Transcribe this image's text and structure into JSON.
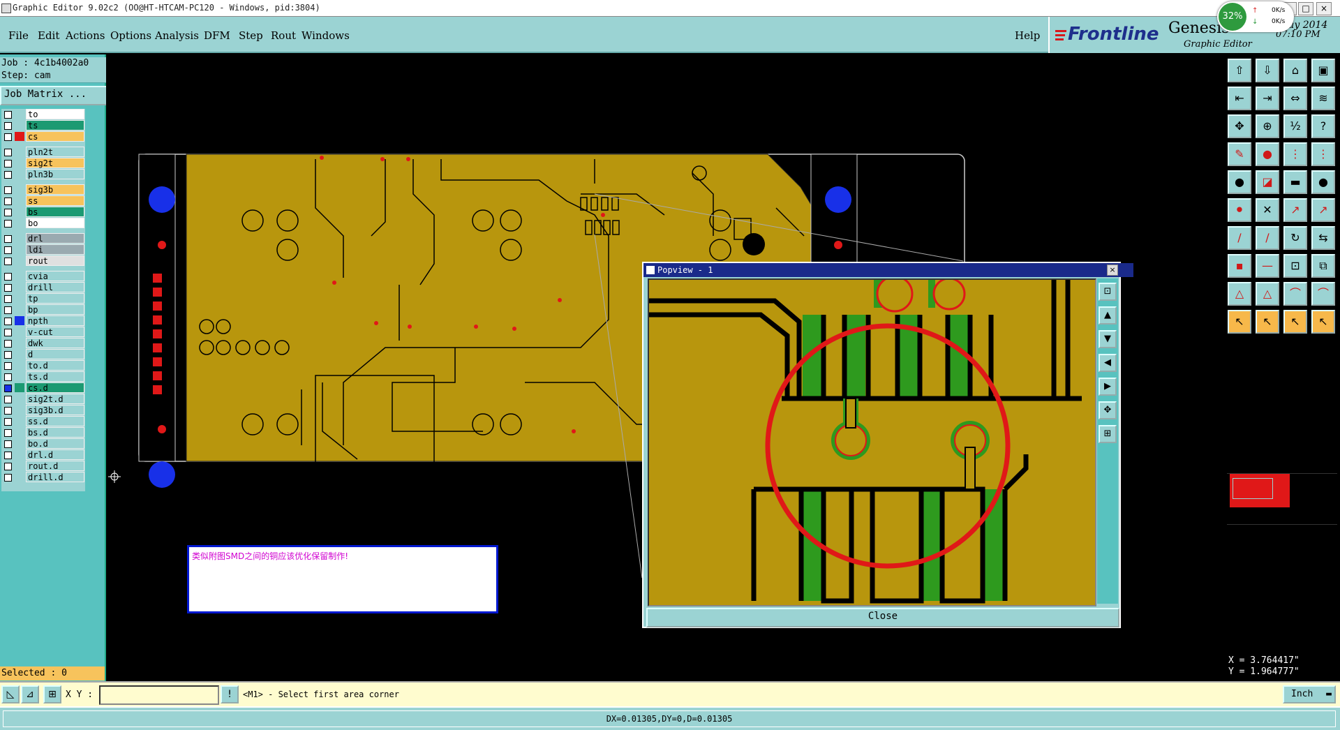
{
  "window": {
    "title": "Graphic Editor 9.02c2 (OO@HT-HTCAM-PC120 - Windows, pid:3804)"
  },
  "menu": [
    "File",
    "Edit",
    "Actions",
    "Options",
    "Analysis",
    "DFM",
    "Step",
    "Rout",
    "Windows"
  ],
  "help_label": "Help",
  "brand": {
    "logo": "Frontline",
    "product": "Genesis",
    "product_sub": "Graphic Editor",
    "date_partial": "ay 2014",
    "time": "07:10 PM",
    "colors": {
      "logo_red": "#d8181c",
      "logo_blue": "#1e2f8c"
    }
  },
  "net_meter": {
    "percent": "32%",
    "up": "0K/s",
    "down": "0K/s",
    "color": "#2e9a3e"
  },
  "job": {
    "job_label": "Job : 4c1b4002a0",
    "step_label": "Step: cam",
    "matrix_button": "Job Matrix ..."
  },
  "layers": [
    {
      "name": "to",
      "bg": "#ffffff",
      "swatch": "",
      "checked": false
    },
    {
      "name": "ts",
      "bg": "#1c9a72",
      "swatch": "",
      "checked": false
    },
    {
      "name": "cs",
      "bg": "#f7c35c",
      "swatch": "#e01818",
      "checked": false
    },
    {
      "name": "pln2t",
      "bg": "#9bd3d3",
      "swatch": "",
      "checked": false
    },
    {
      "name": "sig2t",
      "bg": "#f7c35c",
      "swatch": "",
      "checked": false
    },
    {
      "name": "pln3b",
      "bg": "#9bd3d3",
      "swatch": "",
      "checked": false
    },
    {
      "name": "sig3b",
      "bg": "#f7c35c",
      "swatch": "",
      "checked": false
    },
    {
      "name": "ss",
      "bg": "#f7c35c",
      "swatch": "",
      "checked": false
    },
    {
      "name": "bs",
      "bg": "#1c9a72",
      "swatch": "",
      "checked": false
    },
    {
      "name": "bo",
      "bg": "#ffffff",
      "swatch": "",
      "checked": false
    },
    {
      "name": "drl",
      "bg": "#9aaab0",
      "swatch": "",
      "checked": false
    },
    {
      "name": "ldi",
      "bg": "#9aaab0",
      "swatch": "",
      "checked": false
    },
    {
      "name": "rout",
      "bg": "#e0e0e0",
      "swatch": "",
      "checked": false
    },
    {
      "name": "cvia",
      "bg": "#9bd3d3",
      "swatch": "",
      "checked": false
    },
    {
      "name": "drill",
      "bg": "#9bd3d3",
      "swatch": "",
      "checked": false
    },
    {
      "name": "tp",
      "bg": "#9bd3d3",
      "swatch": "",
      "checked": false
    },
    {
      "name": "bp",
      "bg": "#9bd3d3",
      "swatch": "",
      "checked": false
    },
    {
      "name": "npth",
      "bg": "#9bd3d3",
      "swatch": "#1830e8",
      "checked": false
    },
    {
      "name": "v-cut",
      "bg": "#9bd3d3",
      "swatch": "",
      "checked": false
    },
    {
      "name": "dwk",
      "bg": "#9bd3d3",
      "swatch": "",
      "checked": false
    },
    {
      "name": "d",
      "bg": "#9bd3d3",
      "swatch": "",
      "checked": false
    },
    {
      "name": "to.d",
      "bg": "#9bd3d3",
      "swatch": "",
      "checked": false
    },
    {
      "name": "ts.d",
      "bg": "#9bd3d3",
      "swatch": "",
      "checked": false
    },
    {
      "name": "cs.d",
      "bg": "#1c9a72",
      "swatch": "#1c9a72",
      "checked": true
    },
    {
      "name": "sig2t.d",
      "bg": "#9bd3d3",
      "swatch": "",
      "checked": false
    },
    {
      "name": "sig3b.d",
      "bg": "#9bd3d3",
      "swatch": "",
      "checked": false
    },
    {
      "name": "ss.d",
      "bg": "#9bd3d3",
      "swatch": "",
      "checked": false
    },
    {
      "name": "bs.d",
      "bg": "#9bd3d3",
      "swatch": "",
      "checked": false
    },
    {
      "name": "bo.d",
      "bg": "#9bd3d3",
      "swatch": "",
      "checked": false
    },
    {
      "name": "drl.d",
      "bg": "#9bd3d3",
      "swatch": "",
      "checked": false
    },
    {
      "name": "rout.d",
      "bg": "#9bd3d3",
      "swatch": "",
      "checked": false
    },
    {
      "name": "drill.d",
      "bg": "#9bd3d3",
      "swatch": "",
      "checked": false
    }
  ],
  "selected_label": "Selected : 0",
  "annotation": "类似附图SMD之间的铜应该优化保留制作!",
  "popview": {
    "title": "Popview - 1",
    "close_label": "Close"
  },
  "coords": {
    "x": "X = 3.764417\"",
    "y": "Y = 1.964777\""
  },
  "bottom": {
    "xy_label": "X Y :",
    "xy_value": "",
    "prompt": "<M1> - Select first area corner",
    "unit": "Inch",
    "measure": "DX=0.01305,DY=0,D=0.01305"
  },
  "toolbar_icons": [
    "open-step-icon",
    "save-icon",
    "home-icon",
    "window-icon",
    "pan-left-icon",
    "pan-right-icon",
    "zoom-fit-icon",
    "snap-icon",
    "zoom-area-icon",
    "zoom-icon",
    "scale-icon",
    "help-icon",
    "measure-icon",
    "pad-icon",
    "net-icon",
    "net2-icon",
    "pad-select-icon",
    "drc-icon",
    "line-icon",
    "dot-icon",
    "node-icon",
    "cross-icon",
    "connect-icon",
    "connect2-icon",
    "slash-icon",
    "slash2-icon",
    "arc-icon",
    "flip-icon",
    "add-pad-icon",
    "add-line-icon",
    "add-via-icon",
    "add-cut-icon",
    "delta-icon",
    "delta2-icon",
    "arch-icon",
    "arch2-icon",
    "pointer-icon",
    "select-icon",
    "rotate-select-icon",
    "move-select-icon"
  ],
  "pcb": {
    "copper": "#b8960d",
    "trace": "#000000",
    "highlight": "#2e9a1e",
    "mark": "#e01818"
  }
}
